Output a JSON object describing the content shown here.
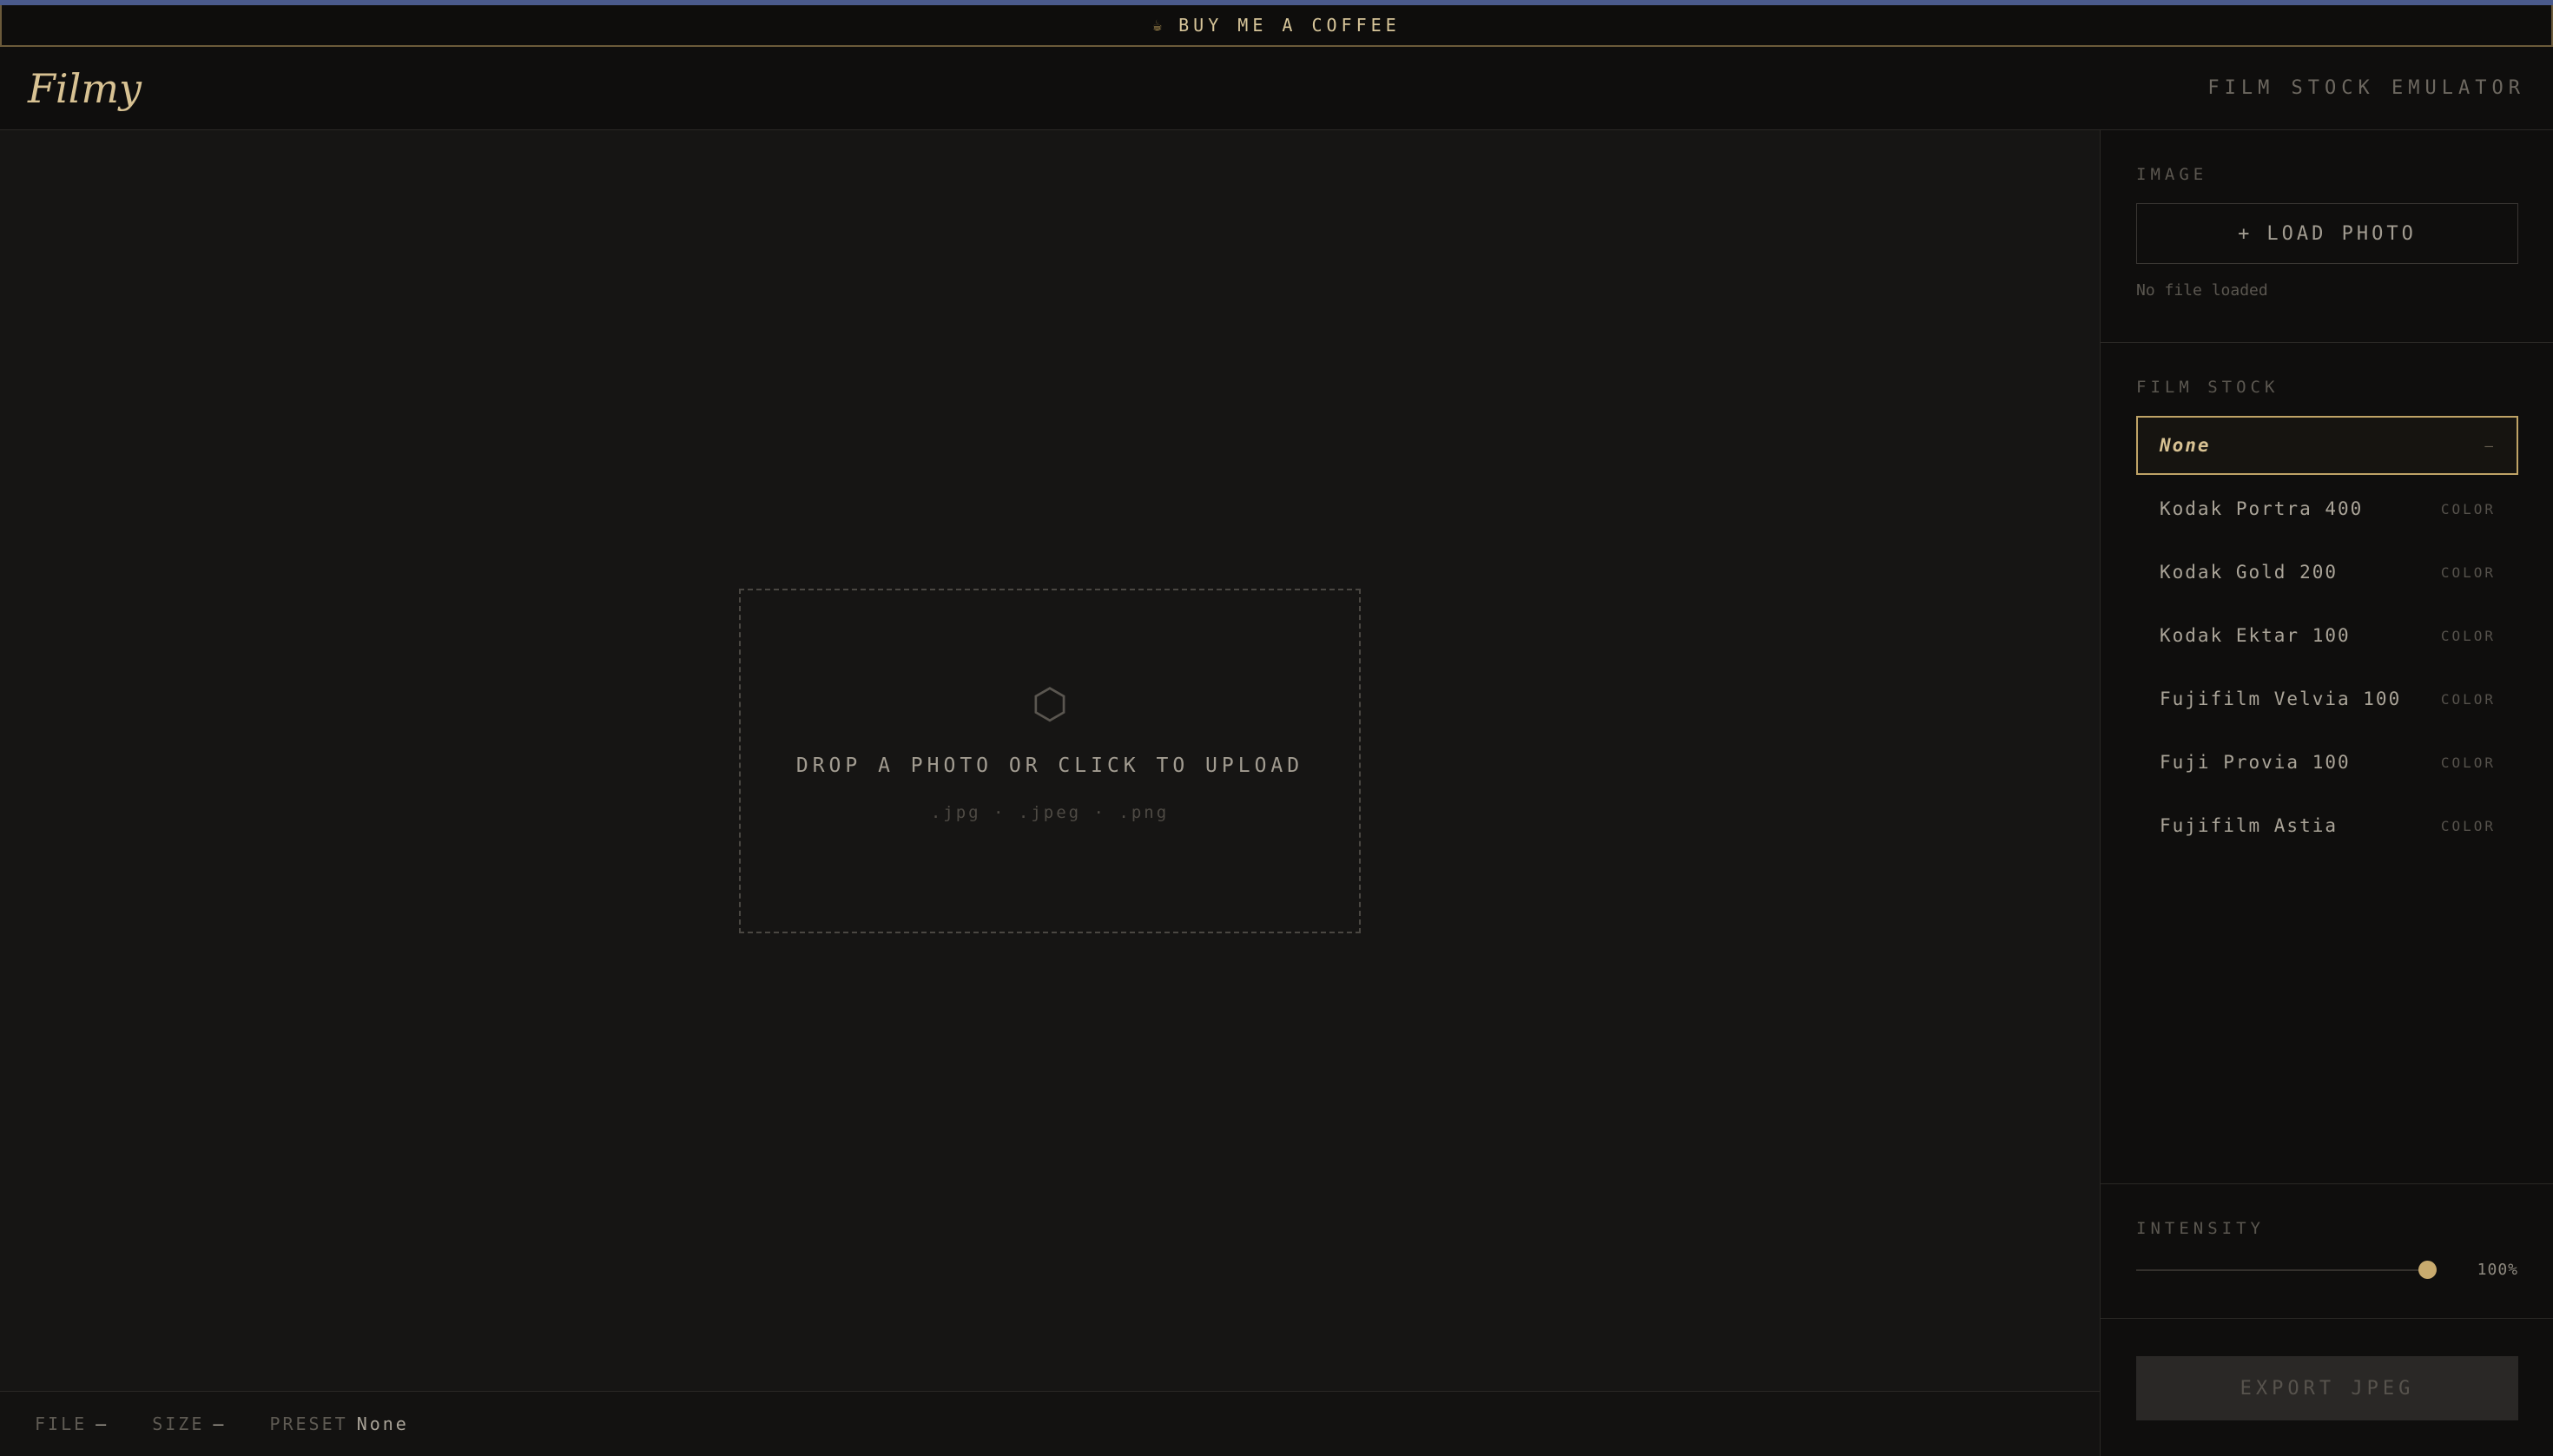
{
  "promo": {
    "cup_icon": "coffee-cup-icon",
    "label": "BUY ME A COFFEE"
  },
  "header": {
    "logo": "Filmy",
    "subtitle": "FILM STOCK EMULATOR"
  },
  "dropzone": {
    "icon": "⬡",
    "title": "DROP A PHOTO OR CLICK TO UPLOAD",
    "formats": ".jpg · .jpeg · .png"
  },
  "statusbar": {
    "file_key": "FILE",
    "file_val": "—",
    "size_key": "SIZE",
    "size_val": "—",
    "preset_key": "PRESET",
    "preset_val": "None"
  },
  "sidebar": {
    "image": {
      "label": "IMAGE",
      "load_icon": "+",
      "load_label": "LOAD PHOTO",
      "status": "No file loaded"
    },
    "film": {
      "label": "FILM STOCK",
      "items": [
        {
          "name": "None",
          "type": "—"
        },
        {
          "name": "Kodak Portra 400",
          "type": "COLOR"
        },
        {
          "name": "Kodak Gold 200",
          "type": "COLOR"
        },
        {
          "name": "Kodak Ektar 100",
          "type": "COLOR"
        },
        {
          "name": "Fujifilm Velvia 100",
          "type": "COLOR"
        },
        {
          "name": "Fuji Provia 100",
          "type": "COLOR"
        },
        {
          "name": "Fujifilm Astia",
          "type": "COLOR"
        }
      ],
      "selected": "None"
    },
    "intensity": {
      "label": "INTENSITY",
      "value": 100,
      "value_text": "100%"
    },
    "export_label": "EXPORT JPEG"
  },
  "colors": {
    "accent": "#c9ab6e",
    "background": "#131211",
    "panel": "#0f0e0d"
  }
}
